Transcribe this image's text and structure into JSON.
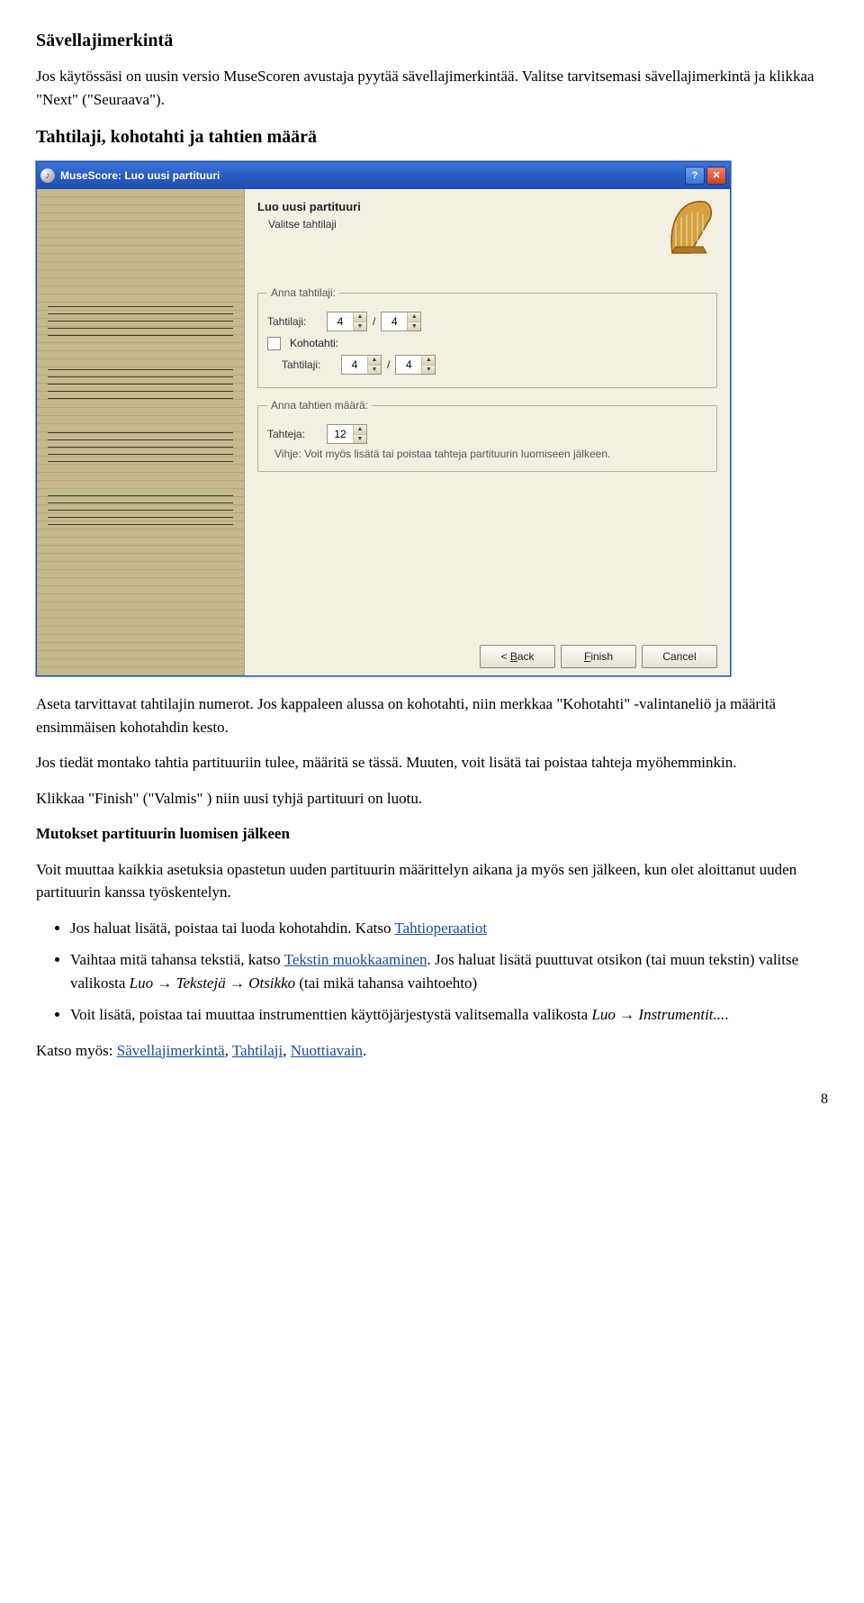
{
  "section1": {
    "heading": "Sävellajimerkintä",
    "p1a": "Jos käytössäsi on uusin versio MuseScoren avustaja pyytää sävellajimerkintää. Valitse tarvitsemasi sävellajimerkintä ja klikkaa \"Next\" (\"Seuraava\").",
    "heading2": "Tahtilaji, kohotahti ja tahtien määrä"
  },
  "dialog": {
    "title": "MuseScore: Luo uusi partituuri",
    "header_h1": "Luo uusi partituuri",
    "header_h2": "Valitse tahtilaji",
    "grp_timesig": "Anna tahtilaji:",
    "lbl_timesig": "Tahtilaji:",
    "timesig_num": "4",
    "timesig_den": "4",
    "chk_pickup": "Kohotahti:",
    "lbl_pickup": "Tahtilaji:",
    "pickup_num": "4",
    "pickup_den": "4",
    "grp_measures": "Anna tahtien määrä:",
    "lbl_measures": "Tahteja:",
    "measures_val": "12",
    "hint": "Vihje: Voit myös lisätä tai poistaa tahteja partituurin luomiseen jälkeen.",
    "btn_back": "< Back",
    "btn_finish": "Finish",
    "btn_cancel": "Cancel"
  },
  "body": {
    "p2": "Aseta tarvittavat tahtilajin numerot. Jos kappaleen alussa on kohotahti, niin merkkaa \"Kohotahti\" -valintaneliö ja määritä ensimmäisen kohotahdin kesto.",
    "p3": "Jos tiedät montako tahtia partituuriin tulee, määritä se tässä. Muuten, voit lisätä tai poistaa tahteja myöhemminkin.",
    "p4": "Klikkaa \"Finish\" (\"Valmis\" ) niin uusi tyhjä partituuri on luotu.",
    "h3": "Mutokset partituurin luomisen jälkeen",
    "p5": "Voit muuttaa kaikkia asetuksia opastetun uuden partituurin määrittelyn aikana ja myös sen jälkeen, kun olet aloittanut uuden partituurin kanssa työskentelyn.",
    "li1a": "Jos haluat lisätä, poistaa tai luoda kohotahdin. Katso ",
    "li1link": "Tahtioperaatiot",
    "li2a": "Vaihtaa mitä tahansa tekstiä, katso ",
    "li2link": "Tekstin muokkaaminen",
    "li2b": ". Jos haluat lisätä puuttuvat otsikon (tai muun tekstin) valitse valikosta ",
    "li2c": "Luo → Tekstejä → Otsikko",
    "li2d": " (tai mikä tahansa vaihtoehto)",
    "li3a": "Voit lisätä, poistaa tai muuttaa instrumenttien käyttöjärjestystä valitsemalla valikosta ",
    "li3b": "Luo → Instrumentit...",
    "li3c": ".",
    "p6a": "Katso myös: ",
    "p6l1": "Sävellajimerkintä",
    "p6s1": ", ",
    "p6l2": "Tahtilaji",
    "p6s2": ", ",
    "p6l3": "Nuottiavain",
    "p6s3": "."
  },
  "page_num": "8"
}
